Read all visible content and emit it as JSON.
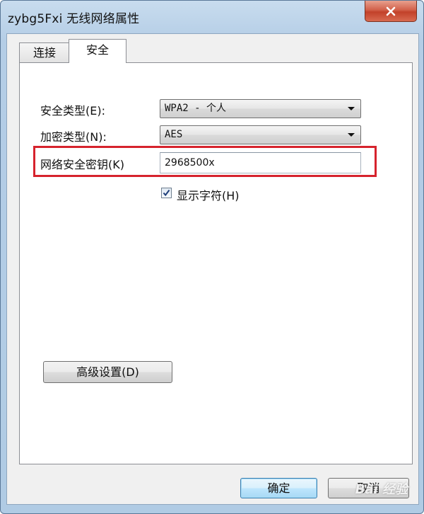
{
  "window": {
    "title": "zybg5Fxi 无线网络属性"
  },
  "tabs": [
    {
      "label": "连接"
    },
    {
      "label": "安全"
    }
  ],
  "security": {
    "security_type_label": "安全类型(E):",
    "security_type_value": "WPA2 - 个人",
    "encryption_type_label": "加密类型(N):",
    "encryption_type_value": "AES",
    "network_key_label": "网络安全密钥(K)",
    "network_key_value": "2968500x",
    "show_chars_label": "显示字符(H)",
    "show_chars_checked": true
  },
  "buttons": {
    "advanced": "高级设置(D)",
    "ok": "确定",
    "cancel": "取消"
  },
  "colors": {
    "highlight": "#d6232d",
    "default_button_border": "#3c7fb1"
  },
  "watermark": {
    "text": "Bai 经验"
  },
  "icons": {
    "close": "close-icon",
    "checkbox": "checkmark-icon",
    "dropdown": "chevron-down-icon"
  }
}
